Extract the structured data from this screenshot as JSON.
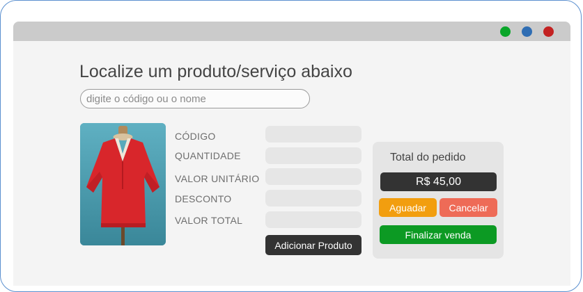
{
  "colors": {
    "accent_border": "#5a8fcf",
    "dot_green": "#0aa62a",
    "dot_blue": "#2f6db3",
    "dot_red": "#c32222",
    "wait_button": "#f29e0f",
    "cancel_button": "#ee6b57",
    "finish_button": "#0c9a23",
    "dark": "#333333"
  },
  "page": {
    "heading": "Localize um produto/serviço abaixo",
    "search_placeholder": "digite o código ou o nome"
  },
  "product": {
    "image_icon": "red-blouse-on-mannequin",
    "fields": [
      {
        "label": "CÓDIGO",
        "value": ""
      },
      {
        "label": "QUANTIDADE",
        "value": ""
      },
      {
        "label": "VALOR UNITÁRIO",
        "value": ""
      },
      {
        "label": "DESCONTO",
        "value": ""
      },
      {
        "label": "VALOR TOTAL",
        "value": ""
      }
    ],
    "add_button": "Adicionar Produto"
  },
  "order": {
    "title": "Total do pedido",
    "total": "R$ 45,00",
    "wait_button": "Aguadar",
    "cancel_button": "Cancelar",
    "finish_button": "Finalizar venda"
  }
}
